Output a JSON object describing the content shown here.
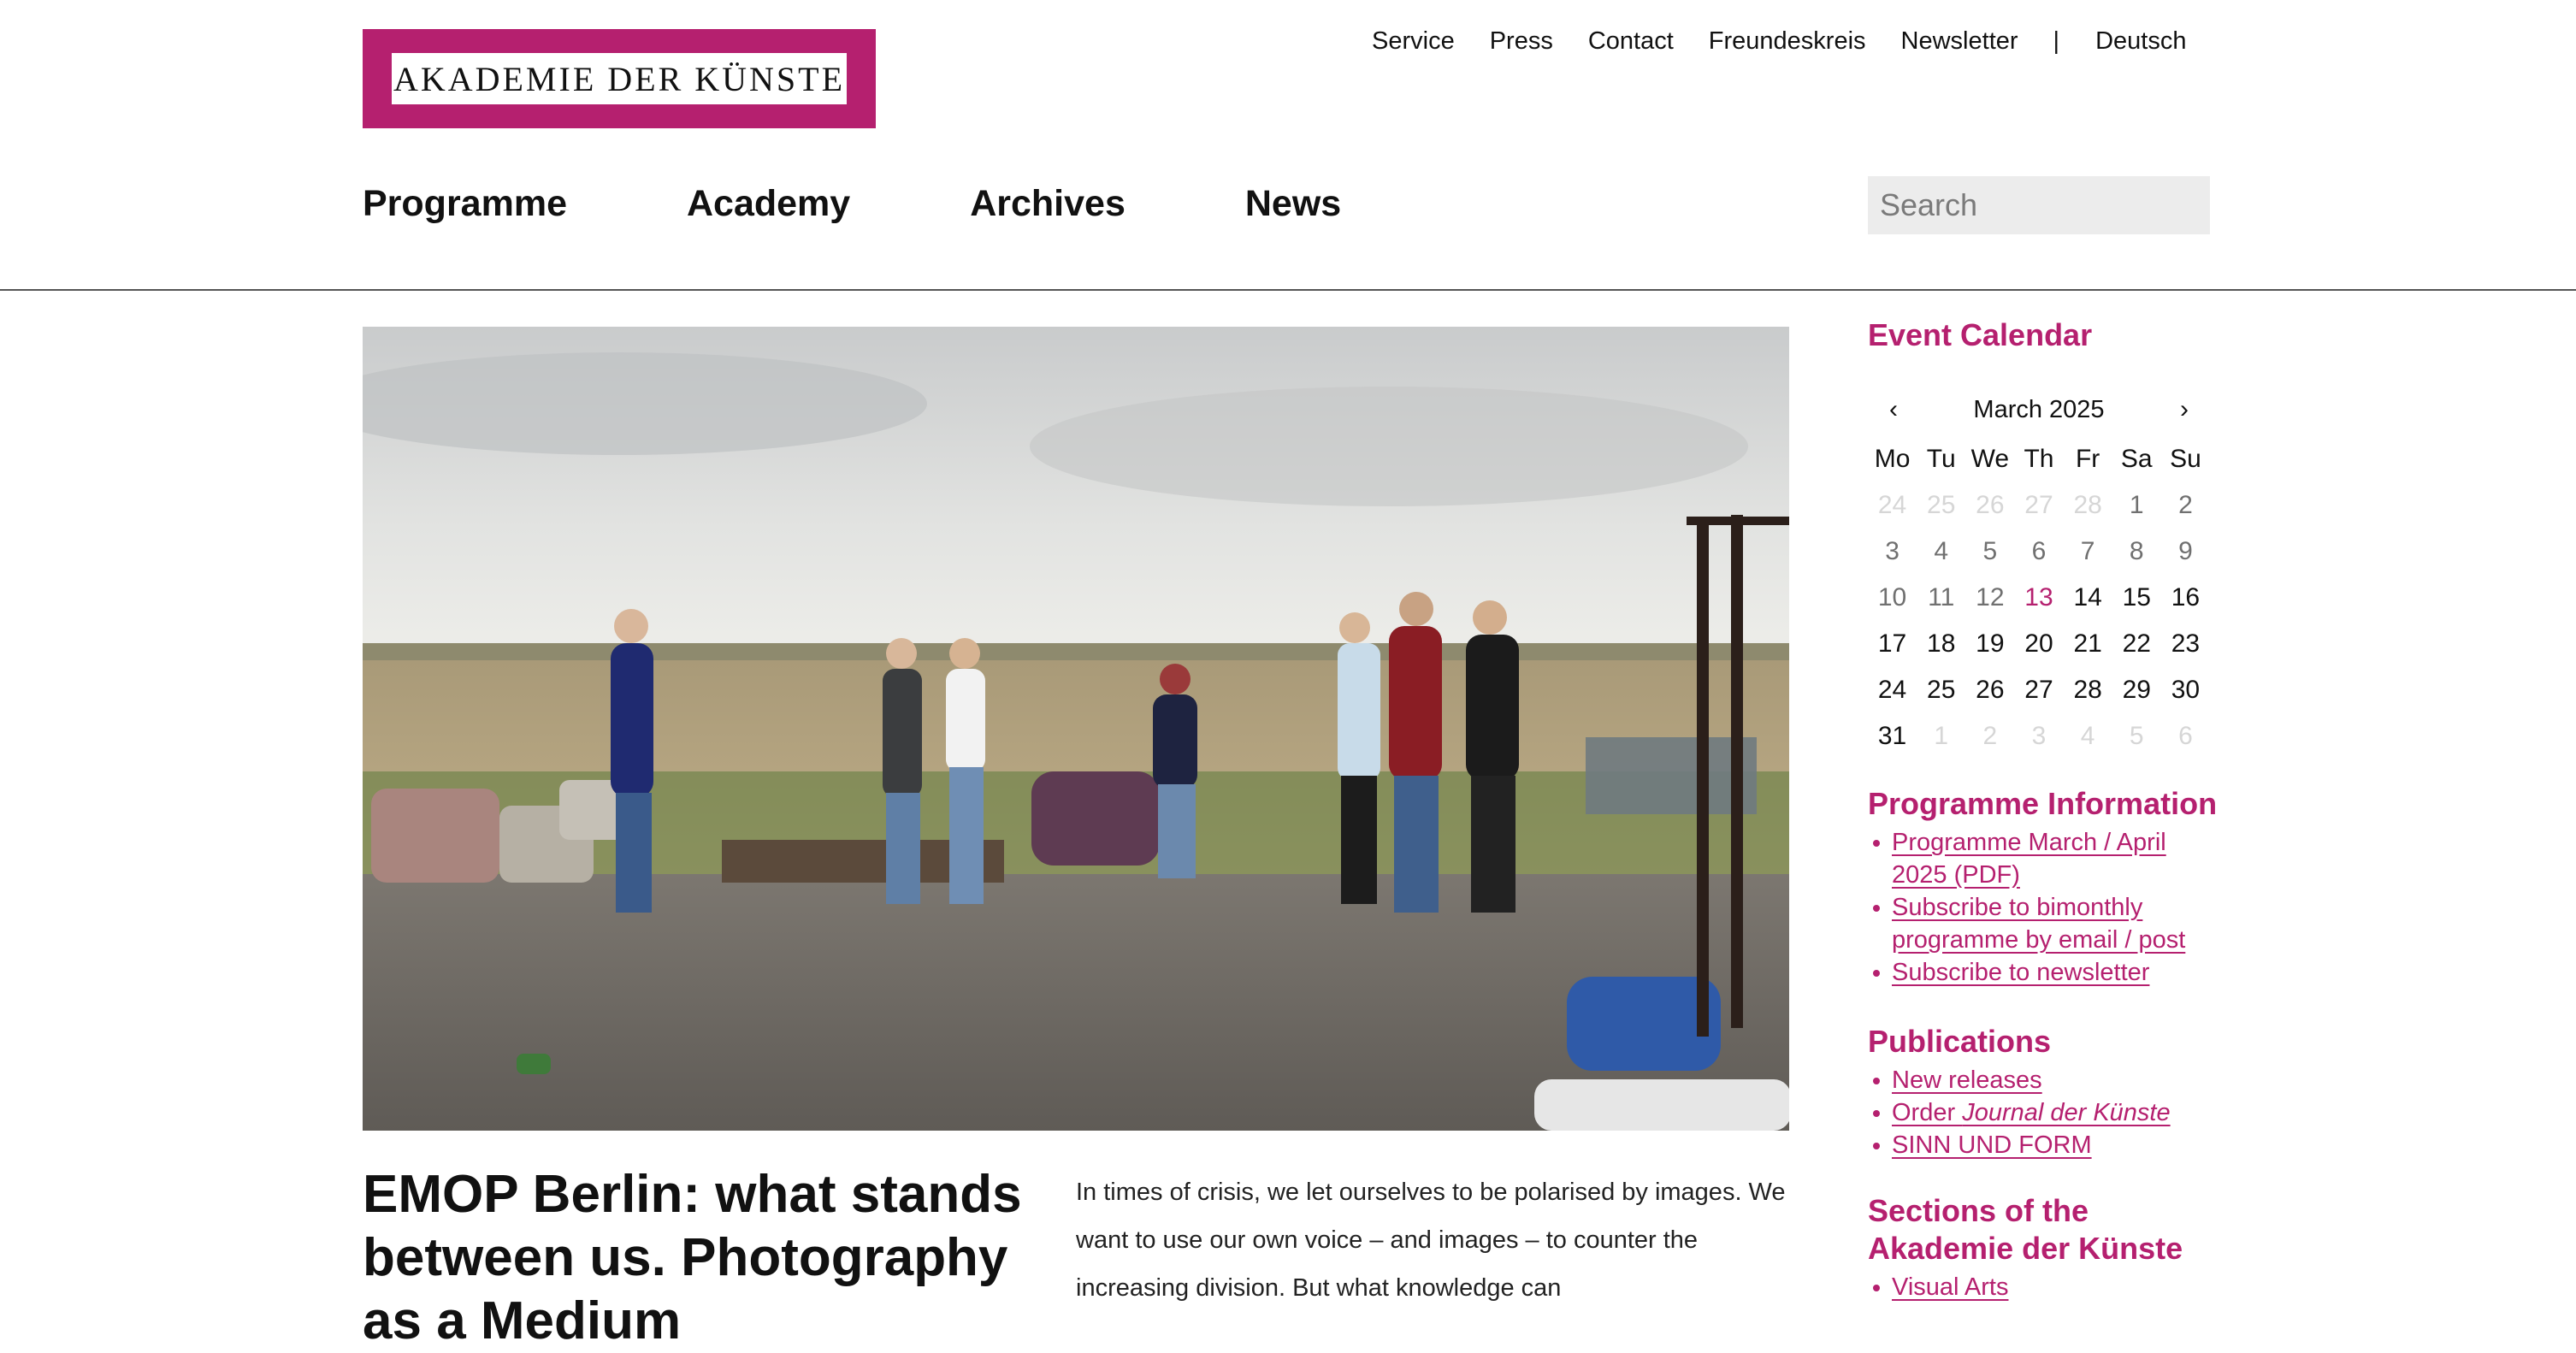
{
  "brand": {
    "logo_text": "AKADEMIE DER KÜNSTE",
    "accent": "#b5206f"
  },
  "service_nav": {
    "items": [
      "Service",
      "Press",
      "Contact",
      "Freundeskreis",
      "Newsletter"
    ],
    "separator": "|",
    "language": "Deutsch"
  },
  "main_nav": {
    "items": [
      "Programme",
      "Academy",
      "Archives",
      "News"
    ]
  },
  "search": {
    "placeholder": "Search",
    "value": ""
  },
  "article": {
    "headline": "EMOP Berlin: what stands between us. Photography as a Medium",
    "intro": "In times of crisis, we let ourselves to be polarised by images. We want to use our own voice – and images – to counter the increasing division. But what knowledge can"
  },
  "calendar": {
    "title": "Event Calendar",
    "month": "March 2025",
    "prev_icon": "chevron-left-icon",
    "next_icon": "chevron-right-icon",
    "weekdays": [
      "Mo",
      "Tu",
      "We",
      "Th",
      "Fr",
      "Sa",
      "Su"
    ],
    "days": [
      {
        "d": "24",
        "s": "muted"
      },
      {
        "d": "25",
        "s": "muted"
      },
      {
        "d": "26",
        "s": "muted"
      },
      {
        "d": "27",
        "s": "muted"
      },
      {
        "d": "28",
        "s": "muted"
      },
      {
        "d": "1",
        "s": "past"
      },
      {
        "d": "2",
        "s": "past"
      },
      {
        "d": "3",
        "s": "past"
      },
      {
        "d": "4",
        "s": "past"
      },
      {
        "d": "5",
        "s": "past"
      },
      {
        "d": "6",
        "s": "past"
      },
      {
        "d": "7",
        "s": "past"
      },
      {
        "d": "8",
        "s": "past"
      },
      {
        "d": "9",
        "s": "past"
      },
      {
        "d": "10",
        "s": "past"
      },
      {
        "d": "11",
        "s": "past"
      },
      {
        "d": "12",
        "s": "past"
      },
      {
        "d": "13",
        "s": "today"
      },
      {
        "d": "14",
        "s": "cur"
      },
      {
        "d": "15",
        "s": "cur"
      },
      {
        "d": "16",
        "s": "cur"
      },
      {
        "d": "17",
        "s": "cur"
      },
      {
        "d": "18",
        "s": "cur"
      },
      {
        "d": "19",
        "s": "cur"
      },
      {
        "d": "20",
        "s": "cur"
      },
      {
        "d": "21",
        "s": "cur"
      },
      {
        "d": "22",
        "s": "cur"
      },
      {
        "d": "23",
        "s": "cur"
      },
      {
        "d": "24",
        "s": "cur"
      },
      {
        "d": "25",
        "s": "cur"
      },
      {
        "d": "26",
        "s": "cur"
      },
      {
        "d": "27",
        "s": "cur"
      },
      {
        "d": "28",
        "s": "cur"
      },
      {
        "d": "29",
        "s": "cur"
      },
      {
        "d": "30",
        "s": "cur"
      },
      {
        "d": "31",
        "s": "cur"
      },
      {
        "d": "1",
        "s": "muted"
      },
      {
        "d": "2",
        "s": "muted"
      },
      {
        "d": "3",
        "s": "muted"
      },
      {
        "d": "4",
        "s": "muted"
      },
      {
        "d": "5",
        "s": "muted"
      },
      {
        "d": "6",
        "s": "muted"
      }
    ]
  },
  "programme_info": {
    "title": "Programme Information",
    "links": [
      "Programme March / April 2025 (PDF)",
      "Subscribe to bimonthly programme by email / post",
      "Subscribe to newsletter"
    ]
  },
  "publications": {
    "title": "Publications",
    "link_new": "New releases",
    "link_order_prefix": "Order ",
    "link_order_em": "Journal der Künste",
    "link_sinn": "SINN UND FORM"
  },
  "sections": {
    "title": "Sections of the Akademie der Künste",
    "links": [
      "Visual Arts"
    ]
  }
}
